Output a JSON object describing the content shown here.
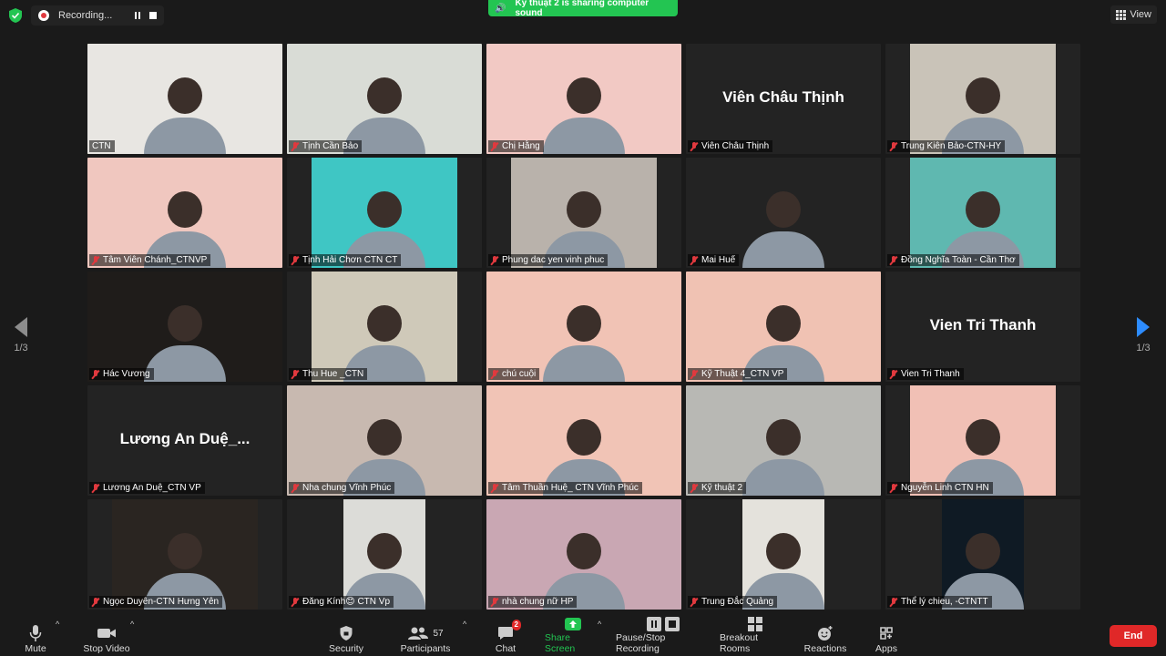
{
  "top": {
    "recording_label": "Recording...",
    "share_banner": "Kỹ thuật 2 is sharing computer sound",
    "view_label": "View"
  },
  "pager": {
    "left": "1/3",
    "right": "1/3"
  },
  "colors": {
    "active_speaker": "#d7e858",
    "share_green": "#23c552",
    "end_red": "#e02828",
    "accent_blue": "#2d8cff"
  },
  "tiles": [
    {
      "name": "CTN",
      "big": "",
      "active": true,
      "bg": "#e8e6e2",
      "w": 214
    },
    {
      "name": "Tịnh Cần Bảo",
      "big": "",
      "bg": "#d9dcd6",
      "w": 214
    },
    {
      "name": "Chị Hằng",
      "big": "",
      "bg": "#f2c9c4",
      "w": 214
    },
    {
      "name": "Viên Châu Thịnh",
      "big": "Viên Châu Thịnh",
      "bg": "#232323",
      "w": 214
    },
    {
      "name": "Trung Kiên Bảo-CTN-HY",
      "big": "",
      "bg": "#c9c3b8",
      "w": 160
    },
    {
      "name": "Tâm Viên Chánh_CTNVP",
      "big": "",
      "bg": "#f0c7bf",
      "w": 214
    },
    {
      "name": "Tịnh Hải Chơn CTN CT",
      "big": "",
      "bg": "#3fc6c4",
      "w": 160
    },
    {
      "name": "Phung dac yen vinh phuc",
      "big": "",
      "bg": "#b9b2ab",
      "w": 160
    },
    {
      "name": "Mai Huế",
      "big": "",
      "bg": "#232323",
      "w": 214
    },
    {
      "name": "Đồng Nghĩa Toàn - Cần Thơ",
      "big": "",
      "bg": "#5fb8b0",
      "w": 160
    },
    {
      "name": "Hác Vương",
      "big": "",
      "bg": "#1f1c1a",
      "w": 214
    },
    {
      "name": "Thu Hue _CTN",
      "big": "",
      "bg": "#cfc9b9",
      "w": 160
    },
    {
      "name": "chú cuội",
      "big": "",
      "bg": "#f1c3b5",
      "w": 214
    },
    {
      "name": "Kỹ Thuật 4_CTN VP",
      "big": "",
      "bg": "#f0c2b3",
      "w": 214
    },
    {
      "name": "Vien Tri Thanh",
      "big": "Vien Tri Thanh",
      "bg": "#232323",
      "w": 214
    },
    {
      "name": "Lương An Duệ_CTN VP",
      "big": "Lương An Duệ_...",
      "bg": "#232323",
      "w": 214
    },
    {
      "name": "Nha chung Vĩnh Phúc",
      "big": "",
      "bg": "#c8b9b0",
      "w": 214
    },
    {
      "name": "Tâm Thuần Huệ_ CTN Vĩnh Phúc",
      "big": "",
      "bg": "#f1c4b6",
      "w": 214
    },
    {
      "name": "Kỹ thuật 2",
      "big": "",
      "bg": "#b8b8b4",
      "w": 214
    },
    {
      "name": "Nguyễn Linh CTN HN",
      "big": "",
      "bg": "#f1c0b5",
      "w": 160
    },
    {
      "name": "Ngọc Duyên-CTN Hưng Yên",
      "big": "",
      "bg": "#2a2521",
      "w": 160
    },
    {
      "name": "Đăng Kính😊 CTN Vp",
      "big": "",
      "bg": "#dcdcd8",
      "w": 90
    },
    {
      "name": "nhà chung nữ HP",
      "big": "",
      "bg": "#c9a7b3",
      "w": 214
    },
    {
      "name": "Trung Đắc Quảng",
      "big": "",
      "bg": "#e4e2dc",
      "w": 90
    },
    {
      "name": "Thể lý chieu, -CTNTT",
      "big": "",
      "bg": "#0f1a24",
      "w": 90
    }
  ],
  "toolbar": {
    "mute": "Mute",
    "stop_video": "Stop Video",
    "security": "Security",
    "participants": "Participants",
    "participants_count": "57",
    "chat": "Chat",
    "chat_badge": "2",
    "share_screen": "Share Screen",
    "pause_stop": "Pause/Stop Recording",
    "breakout": "Breakout Rooms",
    "reactions": "Reactions",
    "apps": "Apps",
    "end": "End"
  }
}
